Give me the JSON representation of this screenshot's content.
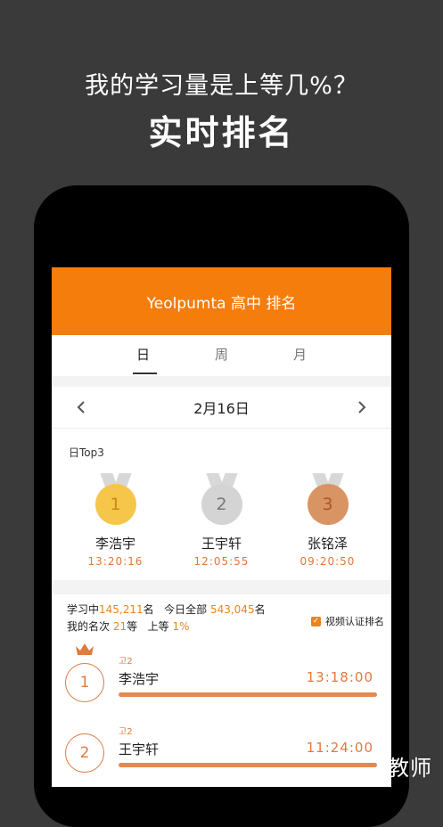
{
  "promo": {
    "line1": "我的学习量是上等几%？",
    "line2": "实时排名"
  },
  "appbar": {
    "title": "Yeolpumta 高中 排名"
  },
  "tabs": [
    {
      "label": "日"
    },
    {
      "label": "周"
    },
    {
      "label": "月"
    }
  ],
  "date": {
    "label": "2月16日"
  },
  "top3": {
    "title": "日Top3",
    "entries": [
      {
        "rank": "1",
        "name": "李浩宇",
        "time": "13:20:16",
        "color": "#f5c64a"
      },
      {
        "rank": "2",
        "name": "王宇轩",
        "time": "12:05:55",
        "color": "#d4d4d4"
      },
      {
        "rank": "3",
        "name": "张铭泽",
        "time": "09:20:50",
        "color": "#d99463"
      }
    ]
  },
  "stats": {
    "studying_label": "学习中",
    "studying_count": "145,211",
    "studying_suffix": "名",
    "today_label": "今日全部",
    "today_count": "543,045",
    "today_suffix": "名",
    "my_rank_label": "我的名次",
    "my_rank": "21",
    "my_rank_suffix": "等",
    "upper_label": "上等",
    "upper_pct": "1%",
    "video_checkbox_label": "视频认证排名"
  },
  "ranking": [
    {
      "rank": "1",
      "grade": "고2",
      "name": "李浩宇",
      "time": "13:18:00",
      "progress": 1.0
    },
    {
      "rank": "2",
      "grade": "고2",
      "name": "王宇轩",
      "time": "11:24:00",
      "progress": 1.0
    }
  ],
  "watermark": "教师",
  "colors": {
    "accent": "#f47d0c",
    "rank_orange": "#e07a40"
  }
}
